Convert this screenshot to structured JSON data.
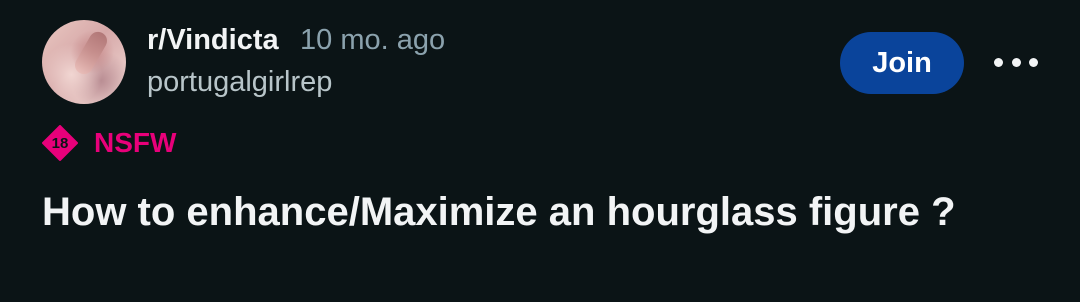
{
  "post": {
    "subreddit": "r/Vindicta",
    "timestamp": "10 mo. ago",
    "username": "portugalgirlrep",
    "join_label": "Join",
    "more_icon": "more-horizontal-icon",
    "nsfw": {
      "badge": "18",
      "label": "NSFW",
      "color": "#e8007a"
    },
    "title": "How to enhance/Maximize an hourglass figure ?"
  },
  "colors": {
    "background": "#0b1416",
    "join_button": "#0a449b",
    "text_primary": "#f2f4f5",
    "text_secondary": "#8ba2ad"
  }
}
